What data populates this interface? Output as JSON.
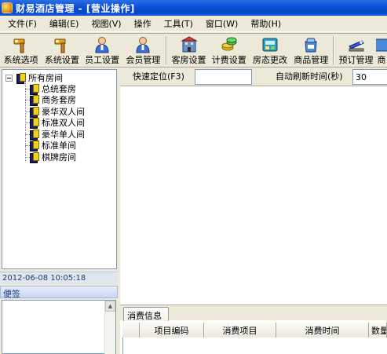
{
  "window": {
    "title": "财易酒店管理 - [营业操作]"
  },
  "menu": [
    {
      "label": "文件(F)"
    },
    {
      "label": "编辑(E)"
    },
    {
      "label": "视图(V)"
    },
    {
      "label": "操作"
    },
    {
      "label": "工具(T)"
    },
    {
      "label": "窗口(W)"
    },
    {
      "label": "帮助(H)"
    }
  ],
  "toolbar": [
    {
      "label": "系统选项",
      "icon": "hammer-icon"
    },
    {
      "label": "系统设置",
      "icon": "hammer-icon"
    },
    {
      "label": "员工设置",
      "icon": "person-icon"
    },
    {
      "label": "会员管理",
      "icon": "person-icon"
    },
    {
      "label": "客房设置",
      "icon": "building-icon"
    },
    {
      "label": "计费设置",
      "icon": "coins-icon"
    },
    {
      "label": "房态更改",
      "icon": "room-status-icon"
    },
    {
      "label": "商品管理",
      "icon": "goods-icon"
    },
    {
      "label": "预订管理",
      "icon": "stapler-icon"
    },
    {
      "label": "商"
    }
  ],
  "tree": {
    "root": "所有房间",
    "children": [
      "总统套房",
      "商务套房",
      "豪华双人间",
      "标准双人间",
      "豪华单人间",
      "标准单间",
      "棋牌房间"
    ]
  },
  "status": {
    "datetime": "2012-06-08 10:05:18"
  },
  "sticky": {
    "title": "便签"
  },
  "search": {
    "quick_label": "快速定位(F3)",
    "quick_value": "",
    "refresh_label": "自动刷新时间(秒)",
    "refresh_value": "30"
  },
  "consumption": {
    "tab": "消费信息",
    "columns": [
      "",
      "项目编码",
      "消费项目",
      "消费时间",
      "数量"
    ]
  },
  "colors": {
    "titlebar": "#0a4fd4",
    "window_bg": "#ece9d8",
    "border": "#7f9db9"
  }
}
